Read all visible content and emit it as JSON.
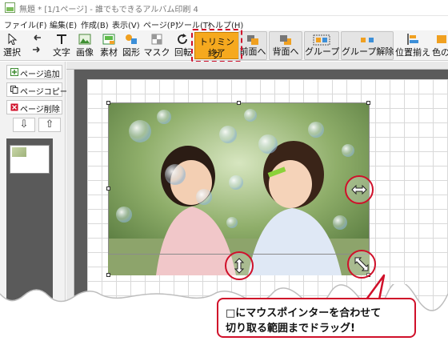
{
  "window": {
    "title": "無題 * [1/1ページ] - 誰でもできるアルバム印刷 4"
  },
  "menu": [
    "ファイル(F)",
    "編集(E)",
    "作成(B)",
    "表示(V)",
    "ページ(P)",
    "ツール(T)",
    "ヘルプ(H)"
  ],
  "toolbar": {
    "select": "選択",
    "undo": "",
    "text": "文字",
    "image": "画像",
    "material": "素材",
    "shape": "図形",
    "mask": "マスク",
    "rotate": "回転",
    "trim_end_line1": "トリミング",
    "trim_end_line2": "終了",
    "front": "前面へ",
    "back": "背面へ",
    "group": "グループ",
    "ungroup": "グループ解除",
    "align": "位置揃え",
    "color": "色の"
  },
  "left_panel": {
    "add_page": "ページ追加",
    "copy_page": "ページコピー",
    "delete_page": "ページ削除",
    "move_down": "⇩",
    "move_up": "⇧"
  },
  "callout": {
    "line1": "□にマウスポインターを合わせて",
    "line2": "切り取る範囲までドラッグ!"
  },
  "colors": {
    "accent_red": "#d0102a",
    "trim_button": "#f6a91e"
  }
}
